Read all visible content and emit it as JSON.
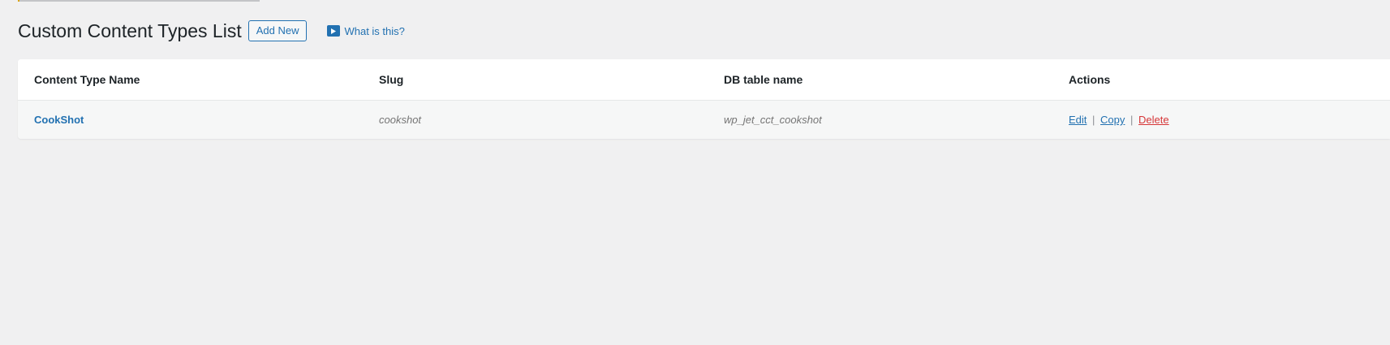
{
  "page": {
    "title": "Custom Content Types List",
    "add_new_label": "Add New",
    "help_link_label": "What is this?"
  },
  "table": {
    "columns": [
      "Content Type Name",
      "Slug",
      "DB table name",
      "Actions"
    ],
    "rows": [
      {
        "name": "CookShot",
        "slug": "cookshot",
        "db_table": "wp_jet_cct_cookshot",
        "actions": {
          "edit": "Edit",
          "copy": "Copy",
          "delete": "Delete",
          "separator": "|"
        }
      }
    ]
  },
  "icons": {
    "help_icon": "play-icon"
  },
  "colors": {
    "background": "#f0f0f1",
    "link": "#2271b1",
    "delete": "#d63638",
    "text": "#1d2327",
    "muted": "#757575"
  }
}
